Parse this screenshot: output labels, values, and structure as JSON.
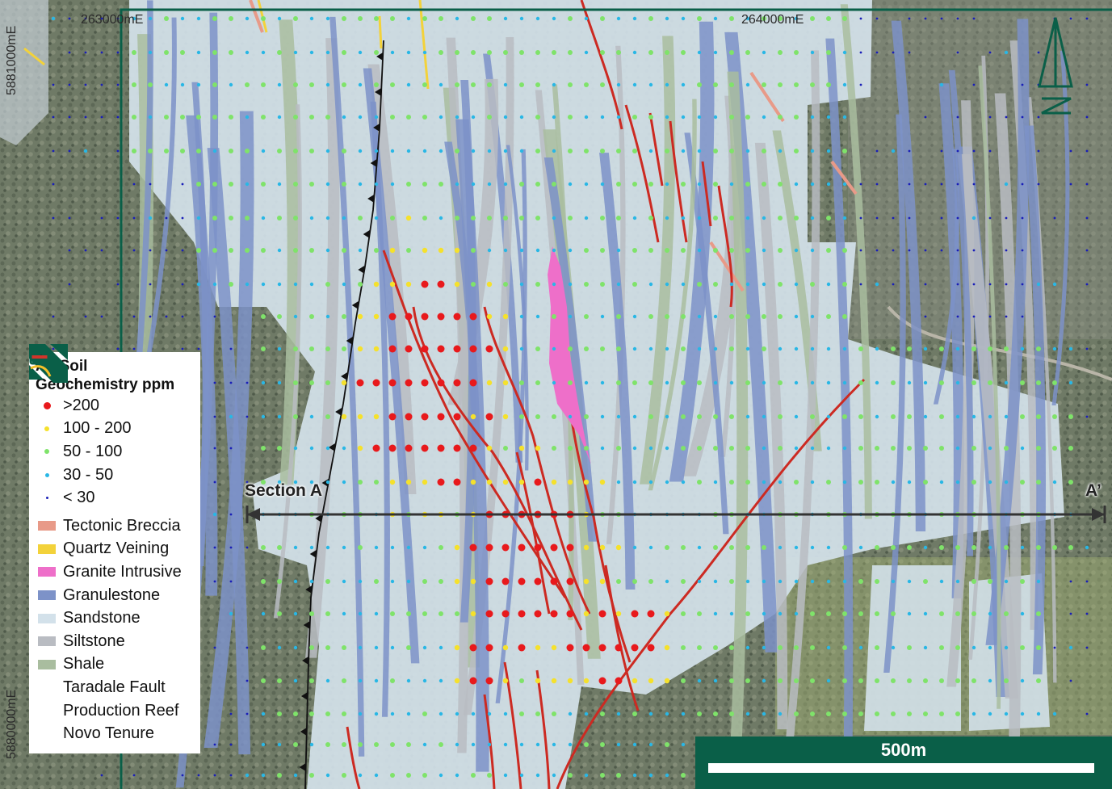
{
  "coordinates": {
    "easting_1": "263000mE",
    "easting_2": "264000mE",
    "northing_1": "5881000mE",
    "northing_2": "5880000mE"
  },
  "legend": {
    "title_line1": "As Soil",
    "title_line2": "Geochemistry ppm",
    "soil_classes": [
      {
        "label": ">200",
        "color": "#e8191c"
      },
      {
        "label": "100 - 200",
        "color": "#f5e12c"
      },
      {
        "label": "50 - 100",
        "color": "#7fe36a"
      },
      {
        "label": "30 - 50",
        "color": "#29b7e5"
      },
      {
        "label": "< 30",
        "color": "#1a1fb8"
      }
    ],
    "units": [
      {
        "label": "Tectonic Breccia",
        "color": "#e89a88"
      },
      {
        "label": "Quartz Veining",
        "color": "#f3d23a"
      },
      {
        "label": "Granite Intrusive",
        "color": "#ee6fc9"
      },
      {
        "label": "Granulestone",
        "color": "#7d92c8"
      },
      {
        "label": "Sandstone",
        "color": "#d3e1ea"
      },
      {
        "label": "Siltstone",
        "color": "#b9bcc2"
      },
      {
        "label": "Shale",
        "color": "#a9bd9f"
      },
      {
        "label": "Taradale Fault",
        "color": "#222222"
      },
      {
        "label": "Production Reef",
        "color": "#d1342a"
      },
      {
        "label": "Novo Tenure",
        "color": "#0a5f48"
      }
    ]
  },
  "section": {
    "start_label": "Section A",
    "end_label": "A’"
  },
  "scale_bar": {
    "label": "500m"
  },
  "colors": {
    "tenure": "#0a5f48",
    "fault": "#111111",
    "reef": "#cc2a22",
    "section_line": "#333333"
  }
}
